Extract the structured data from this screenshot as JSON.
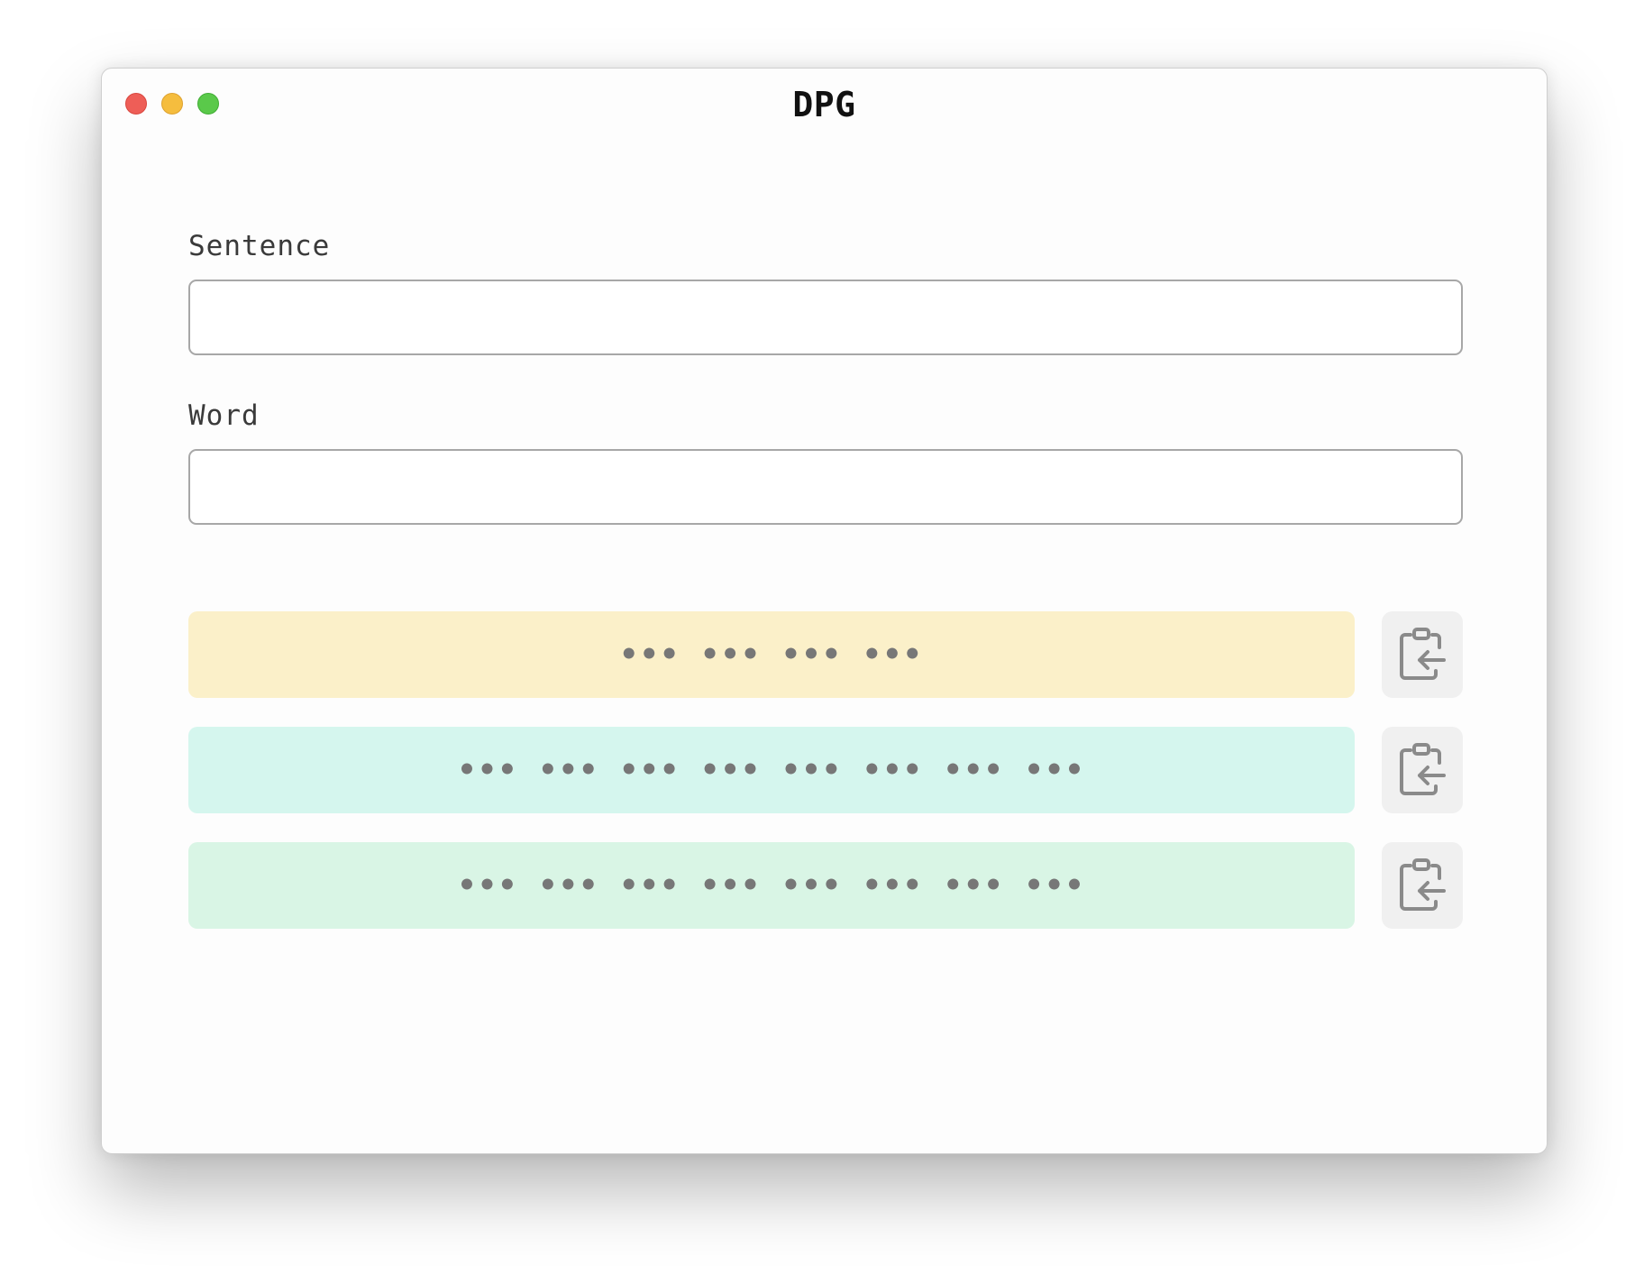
{
  "window": {
    "title": "DPG",
    "traffic_lights": [
      {
        "name": "close",
        "color": "#ee5e57"
      },
      {
        "name": "minimize",
        "color": "#f5bd3e"
      },
      {
        "name": "zoom",
        "color": "#5ac94a"
      }
    ]
  },
  "form": {
    "sentence": {
      "label": "Sentence",
      "value": "",
      "placeholder": ""
    },
    "word": {
      "label": "Word",
      "value": "",
      "placeholder": ""
    }
  },
  "outputs": [
    {
      "text": "••• ••• ••• •••",
      "color": "#fbf0c9",
      "copy_icon": "clipboard-paste-icon"
    },
    {
      "text": "••• ••• ••• ••• ••• ••• ••• •••",
      "color": "#d5f6ee",
      "copy_icon": "clipboard-paste-icon"
    },
    {
      "text": "••• ••• ••• ••• ••• ••• ••• •••",
      "color": "#d9f5e5",
      "copy_icon": "clipboard-paste-icon"
    }
  ]
}
